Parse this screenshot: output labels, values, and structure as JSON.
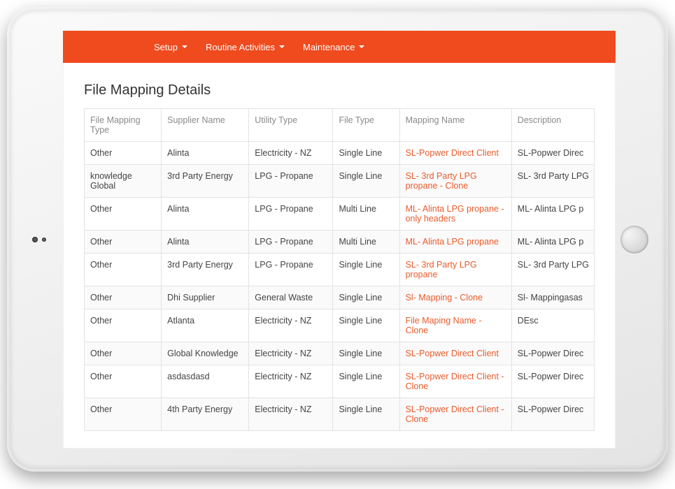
{
  "nav": {
    "items": [
      {
        "label": "Setup"
      },
      {
        "label": "Routine Activities"
      },
      {
        "label": "Maintenance"
      }
    ]
  },
  "page": {
    "title": "File Mapping Details"
  },
  "table": {
    "headers": [
      "File Mapping Type",
      "Supplier Name",
      "Utility Type",
      "File Type",
      "Mapping Name",
      "Description"
    ],
    "rows": [
      {
        "type": "Other",
        "supplier": "Alinta",
        "utility": "Electricity - NZ",
        "file": "Single Line",
        "mapping": "SL-Popwer Direct Client",
        "desc": "SL-Popwer Direc"
      },
      {
        "type": "knowledge Global",
        "supplier": "3rd Party Energy",
        "utility": "LPG - Propane",
        "file": "Single Line",
        "mapping": "SL- 3rd Party LPG propane - Clone",
        "desc": "SL- 3rd Party LPG"
      },
      {
        "type": "Other",
        "supplier": "Alinta",
        "utility": "LPG - Propane",
        "file": "Multi Line",
        "mapping": "ML- Alinta LPG propane - only headers",
        "desc": "ML- Alinta LPG p"
      },
      {
        "type": "Other",
        "supplier": "Alinta",
        "utility": "LPG - Propane",
        "file": "Multi Line",
        "mapping": "ML- Alinta LPG propane",
        "desc": "ML- Alinta LPG p"
      },
      {
        "type": "Other",
        "supplier": "3rd Party Energy",
        "utility": "LPG - Propane",
        "file": "Single Line",
        "mapping": "SL- 3rd Party LPG propane",
        "desc": "SL- 3rd Party LPG"
      },
      {
        "type": "Other",
        "supplier": "Dhi Supplier",
        "utility": "General Waste",
        "file": "Single Line",
        "mapping": "Sl- Mapping - Clone",
        "desc": "Sl- Mappingasas"
      },
      {
        "type": "Other",
        "supplier": "Atlanta",
        "utility": "Electricity - NZ",
        "file": "Single Line",
        "mapping": "File Maping Name - Clone",
        "desc": "DEsc"
      },
      {
        "type": "Other",
        "supplier": "Global Knowledge",
        "utility": "Electricity - NZ",
        "file": "Single Line",
        "mapping": "SL-Popwer Direct Client",
        "desc": "SL-Popwer Direc"
      },
      {
        "type": "Other",
        "supplier": "asdasdasd",
        "utility": "Electricity - NZ",
        "file": "Single Line",
        "mapping": "SL-Popwer Direct Client - Clone",
        "desc": "SL-Popwer Direc"
      },
      {
        "type": "Other",
        "supplier": "4th Party Energy",
        "utility": "Electricity - NZ",
        "file": "Single Line",
        "mapping": "SL-Popwer Direct Client - Clone",
        "desc": "SL-Popwer Direc"
      }
    ]
  }
}
